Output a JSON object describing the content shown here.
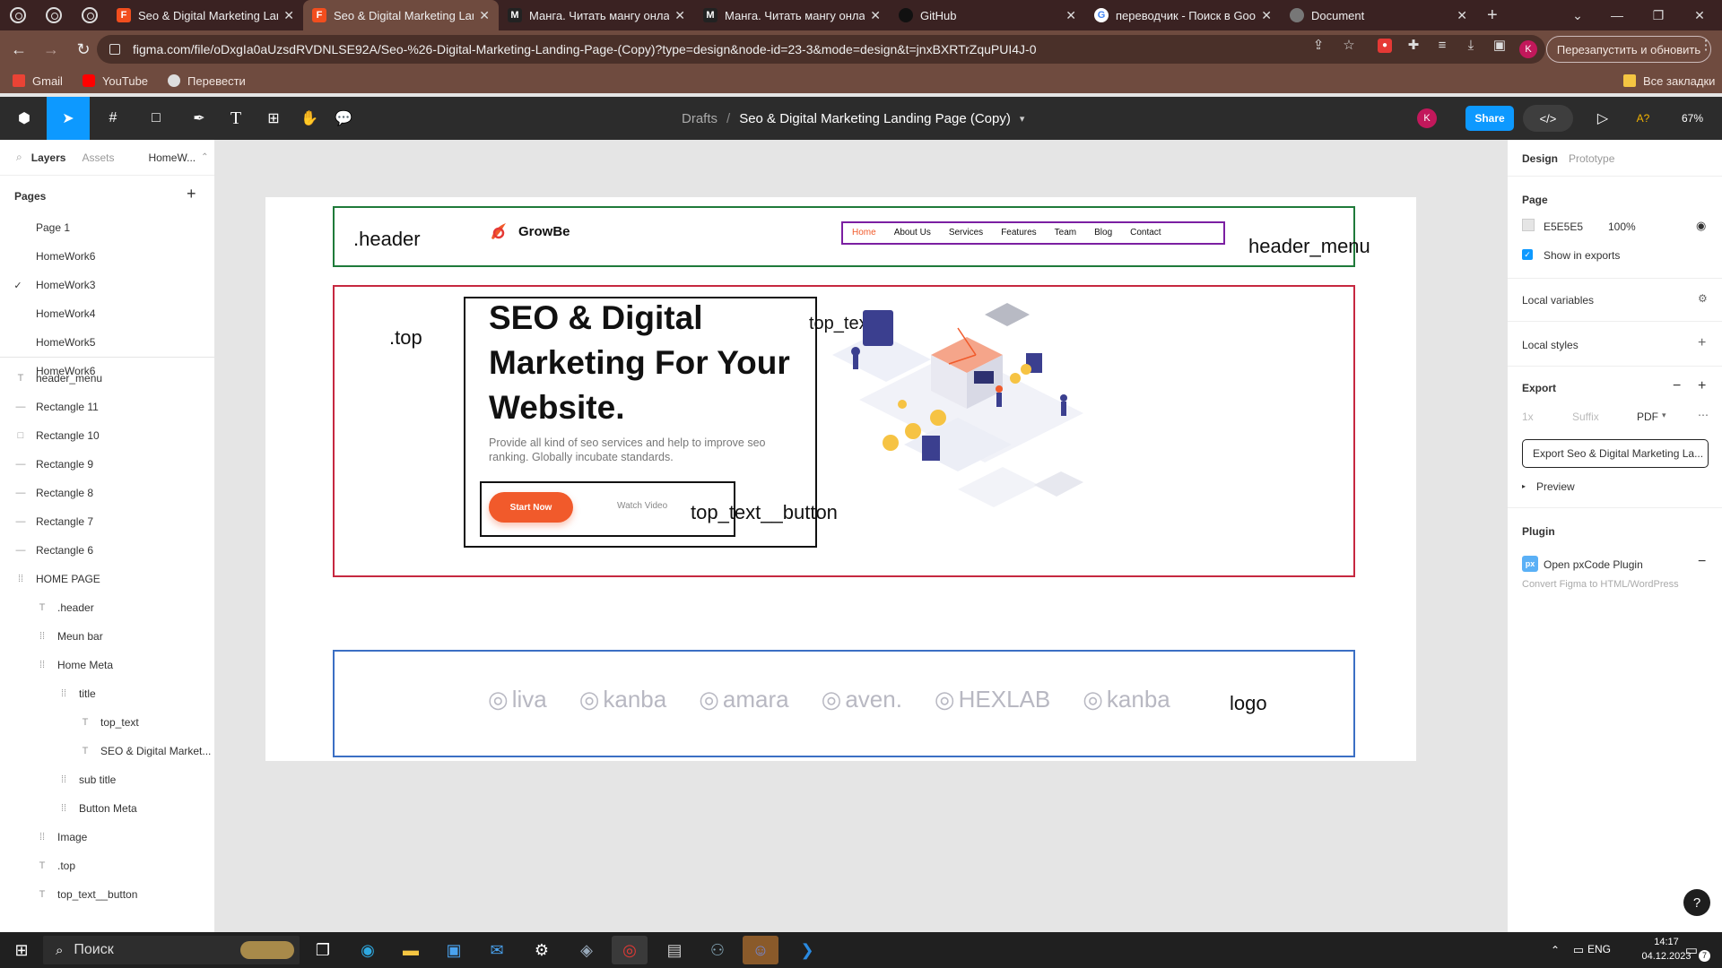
{
  "browser": {
    "tabs": [
      {
        "title": "Seo & Digital Marketing Lan",
        "active": false
      },
      {
        "title": "Seo & Digital Marketing Lan",
        "active": true
      },
      {
        "title": "Манга. Читать мангу онлай",
        "active": false
      },
      {
        "title": "Манга. Читать мангу онлай",
        "active": false
      },
      {
        "title": "GitHub",
        "active": false
      },
      {
        "title": "переводчик - Поиск в Goo",
        "active": false
      },
      {
        "title": "Document",
        "active": false
      }
    ],
    "url": "figma.com/file/oDxgIa0aUzsdRVDNLSE92A/Seo-%26-Digital-Marketing-Landing-Page-(Copy)?type=design&node-id=23-3&mode=design&t=jnxBXRTrZquPUI4J-0",
    "restart_button": "Перезапустить и обновить",
    "profile_initial": "K",
    "bookmarks": [
      "Gmail",
      "YouTube",
      "Перевести"
    ],
    "all_bookmarks": "Все закладки"
  },
  "figma": {
    "breadcrumb_root": "Drafts",
    "breadcrumb_sep": "/",
    "file_title": "Seo & Digital Marketing Landing Page (Copy)",
    "share_label": "Share",
    "user_initial": "K",
    "help_label": "A?",
    "zoom": "67%"
  },
  "left_panel": {
    "tabs": [
      "Layers",
      "Assets",
      "HomeW..."
    ],
    "pages_title": "Pages",
    "pages": [
      "Page 1",
      "HomeWork6",
      "HomeWork3",
      "HomeWork4",
      "HomeWork5",
      "HomeWork6"
    ],
    "current_page": "HomeWork3",
    "layers": [
      {
        "name": "header_menu",
        "type": "text",
        "indent": 0
      },
      {
        "name": "Rectangle 11",
        "type": "line",
        "indent": 0
      },
      {
        "name": "Rectangle 10",
        "type": "rect",
        "indent": 0
      },
      {
        "name": "Rectangle 9",
        "type": "line",
        "indent": 0
      },
      {
        "name": "Rectangle 8",
        "type": "line",
        "indent": 0
      },
      {
        "name": "Rectangle 7",
        "type": "line",
        "indent": 0
      },
      {
        "name": "Rectangle 6",
        "type": "line",
        "indent": 0
      },
      {
        "name": "HOME PAGE",
        "type": "group",
        "indent": 0
      },
      {
        "name": ".header",
        "type": "text",
        "indent": 1
      },
      {
        "name": "Meun bar",
        "type": "group",
        "indent": 1
      },
      {
        "name": "Home Meta",
        "type": "group",
        "indent": 1
      },
      {
        "name": "title",
        "type": "group",
        "indent": 2
      },
      {
        "name": "top_text",
        "type": "text",
        "indent": 3
      },
      {
        "name": "SEO & Digital Market...",
        "type": "text",
        "indent": 3
      },
      {
        "name": "sub title",
        "type": "group",
        "indent": 2
      },
      {
        "name": "Button Meta",
        "type": "group",
        "indent": 2
      },
      {
        "name": "Image",
        "type": "group",
        "indent": 1
      },
      {
        "name": ".top",
        "type": "text",
        "indent": 1
      },
      {
        "name": "top_text__button",
        "type": "text",
        "indent": 1
      }
    ]
  },
  "canvas": {
    "labels": {
      "header": ".header",
      "header_menu": "header_menu",
      "top": ".top",
      "top_text": "top_text",
      "top_text_button": "top_text__button",
      "logo": "logo"
    },
    "site": {
      "brand": "GrowBe",
      "nav": [
        "Home",
        "About Us",
        "Services",
        "Features",
        "Team",
        "Blog",
        "Contact"
      ],
      "hero_title": "SEO & Digital Marketing For Your Website.",
      "hero_sub": "Provide all kind of seo services and help to improve seo ranking. Globally incubate standards.",
      "start_button": "Start Now",
      "watch_button": "Watch Video",
      "partners": [
        "liva",
        "kanba",
        "amara",
        "aven.",
        "HEXLAB",
        "kanba"
      ]
    },
    "colors": {
      "header_box": "#1f7a3a",
      "header_menu_box": "#7b1fa2",
      "top_box": "#c62840",
      "logo_box": "#3b6fc4",
      "accent": "#f15a2b"
    }
  },
  "right_panel": {
    "tabs": [
      "Design",
      "Prototype"
    ],
    "page_title": "Page",
    "page_color": "E5E5E5",
    "page_opacity": "100%",
    "show_in_exports": "Show in exports",
    "local_variables": "Local variables",
    "local_styles": "Local styles",
    "export_title": "Export",
    "export_scale": "1x",
    "export_suffix": "Suffix",
    "export_format": "PDF",
    "export_button": "Export Seo & Digital Marketing La...",
    "preview": "Preview",
    "plugin_title": "Plugin",
    "plugin_name": "Open pxCode Plugin",
    "plugin_desc": "Convert Figma to HTML/WordPress",
    "help": "?"
  },
  "taskbar": {
    "search": "Поиск",
    "lang": "ENG",
    "time": "14:17",
    "date": "04.12.2023",
    "notifications": "7"
  }
}
